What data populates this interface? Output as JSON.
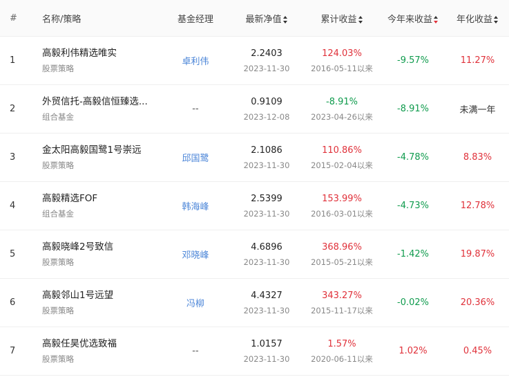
{
  "header": {
    "idx": "#",
    "name": "名称/策略",
    "manager": "基金经理",
    "nav": "最新净值",
    "cumulative": "累计收益",
    "ytd": "今年来收益",
    "annualized": "年化收益"
  },
  "colors": {
    "positive": "#e0313a",
    "negative": "#0f9b4d",
    "link": "#4c86d8",
    "active_sort": "#e0313a"
  },
  "rows": [
    {
      "idx": "1",
      "name": "高毅利伟精选唯实",
      "type": "股票策略",
      "manager": "卓利伟",
      "nav": "2.2403",
      "nav_date": "2023-11-30",
      "cum": "124.03%",
      "cum_since": "2016-05-11以来",
      "ytd": "-9.57%",
      "ann": "11.27%"
    },
    {
      "idx": "2",
      "name": "外贸信托-高毅信恒臻选...",
      "type": "组合基金",
      "manager": "--",
      "nav": "0.9109",
      "nav_date": "2023-12-08",
      "cum": "-8.91%",
      "cum_since": "2023-04-26以来",
      "ytd": "-8.91%",
      "ann": "未满一年"
    },
    {
      "idx": "3",
      "name": "金太阳高毅国鹭1号崇远",
      "type": "股票策略",
      "manager": "邱国鹭",
      "nav": "2.1086",
      "nav_date": "2023-11-30",
      "cum": "110.86%",
      "cum_since": "2015-02-04以来",
      "ytd": "-4.78%",
      "ann": "8.83%"
    },
    {
      "idx": "4",
      "name": "高毅精选FOF",
      "type": "组合基金",
      "manager": "韩海峰",
      "nav": "2.5399",
      "nav_date": "2023-11-30",
      "cum": "153.99%",
      "cum_since": "2016-03-01以来",
      "ytd": "-4.73%",
      "ann": "12.78%"
    },
    {
      "idx": "5",
      "name": "高毅晓峰2号致信",
      "type": "股票策略",
      "manager": "邓晓峰",
      "nav": "4.6896",
      "nav_date": "2023-11-30",
      "cum": "368.96%",
      "cum_since": "2015-05-21以来",
      "ytd": "-1.42%",
      "ann": "19.87%"
    },
    {
      "idx": "6",
      "name": "高毅邻山1号远望",
      "type": "股票策略",
      "manager": "冯柳",
      "nav": "4.4327",
      "nav_date": "2023-11-30",
      "cum": "343.27%",
      "cum_since": "2015-11-17以来",
      "ytd": "-0.02%",
      "ann": "20.36%"
    },
    {
      "idx": "7",
      "name": "高毅任昊优选致福",
      "type": "股票策略",
      "manager": "--",
      "nav": "1.0157",
      "nav_date": "2023-11-30",
      "cum": "1.57%",
      "cum_since": "2020-06-11以来",
      "ytd": "1.02%",
      "ann": "0.45%"
    }
  ]
}
